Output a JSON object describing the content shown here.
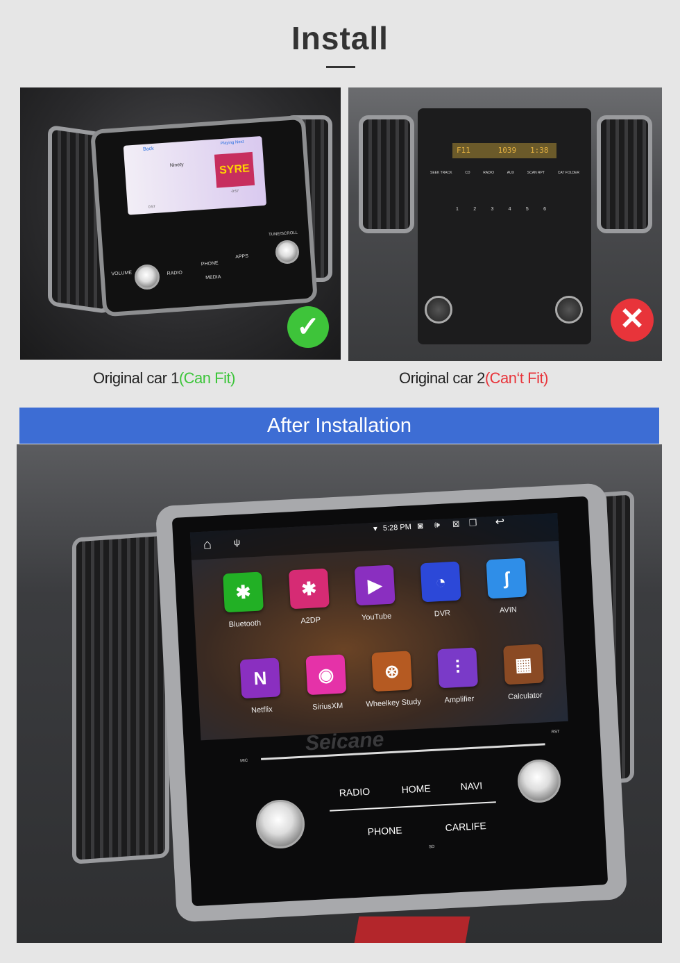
{
  "header": {
    "title": "Install"
  },
  "cars": [
    {
      "caption": "Original car 1",
      "status": "(Can Fit)",
      "status_color": "#3cc53a",
      "badge": "check-icon",
      "screen": {
        "back": "Back",
        "playing_next": "Playing Next",
        "track": "Ninety",
        "artist": "SYRE",
        "time_start": "0:57",
        "time_end": "-0:57"
      },
      "controls": {
        "volume": "VOLUME",
        "radio": "RADIO",
        "phone": "PHONE",
        "apps": "APPS",
        "media": "MEDIA",
        "tune": "TUNE/SCROLL"
      }
    },
    {
      "caption": "Original car 2",
      "status": "(Can‘t Fit)",
      "status_color": "#e8343a",
      "badge": "close-icon",
      "display": "F11      1039   1:38",
      "buttons": [
        "SEEK TRACK",
        "CD",
        "RADIO",
        "AUX",
        "SCAN RPT",
        "CAT FOLDER"
      ],
      "presets": [
        "1",
        "2",
        "3",
        "4",
        "5",
        "6"
      ]
    }
  ],
  "after": {
    "title": "After Installation",
    "accent": "#3d6dd4"
  },
  "head_unit": {
    "status": {
      "time": "5:28 PM"
    },
    "apps": [
      {
        "label": "Bluetooth",
        "color": "#22b025",
        "icon": "bluetooth-icon",
        "glyph": "✱"
      },
      {
        "label": "A2DP",
        "color": "#d62b74",
        "icon": "bluetooth-audio-icon",
        "glyph": "✱"
      },
      {
        "label": "YouTube",
        "color": "#8a2fc0",
        "icon": "youtube-icon",
        "glyph": "▶"
      },
      {
        "label": "DVR",
        "color": "#2c48d8",
        "icon": "dvr-icon",
        "glyph": "◔"
      },
      {
        "label": "AVIN",
        "color": "#2f8ee8",
        "icon": "avin-icon",
        "glyph": "ʃ"
      },
      {
        "label": "Netflix",
        "color": "#8a2fc0",
        "icon": "netflix-icon",
        "glyph": "N"
      },
      {
        "label": "SiriusXM",
        "color": "#e532a8",
        "icon": "siriusxm-icon",
        "glyph": "◉"
      },
      {
        "label": "Wheelkey Study",
        "color": "#b55a22",
        "icon": "steering-wheel-icon",
        "glyph": "⊛"
      },
      {
        "label": "Amplifier",
        "color": "#7a3ac8",
        "icon": "equalizer-icon",
        "glyph": "⫶"
      },
      {
        "label": "Calculator",
        "color": "#8a4a24",
        "icon": "calculator-icon",
        "glyph": "▦"
      }
    ],
    "brand": "Seicane",
    "buttons": {
      "radio": "RADIO",
      "home": "HOME",
      "navi": "NAVI",
      "phone": "PHONE",
      "carlife": "CARLIFE",
      "mic": "MIC",
      "rst": "RST",
      "sd": "SD"
    }
  }
}
